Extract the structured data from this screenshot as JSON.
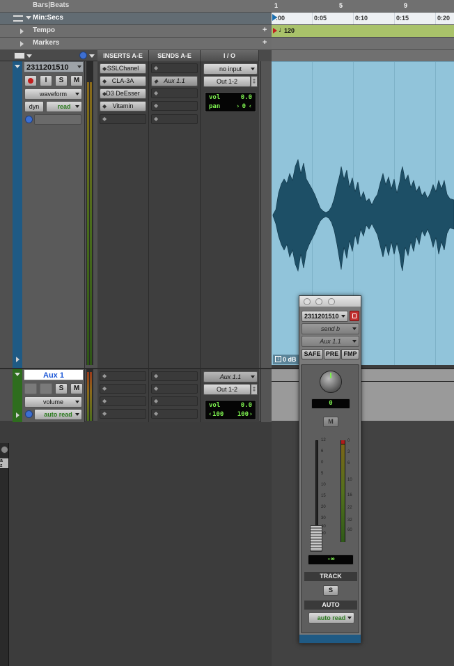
{
  "rulers": {
    "bars_beats": "Bars|Beats",
    "min_secs": "Min:Secs",
    "tempo": "Tempo",
    "markers": "Markers",
    "bar_ticks": [
      "1",
      "5",
      "9"
    ],
    "time_ticks": [
      ":00",
      "0:05",
      "0:10",
      "0:15",
      "0:20"
    ],
    "tempo_value": "120",
    "plus": "+"
  },
  "columns": {
    "inserts": "INSERTS A-E",
    "sends": "SENDS A-E",
    "io": "I / O"
  },
  "track1": {
    "name": "2311201510",
    "buttons": [
      "I",
      "S",
      "M"
    ],
    "view": "waveform",
    "dyn": "dyn",
    "automation": "read",
    "inserts": [
      "SSLChanel",
      "CLA-3A",
      "D3 DeEsser",
      "Vitamin"
    ],
    "send": "Aux 1.1",
    "input": "no input",
    "output": "Out 1-2",
    "vol_label": "vol",
    "vol_value": "0.0",
    "pan_label": "pan",
    "pan_value": "0",
    "clip_db": "0 dB",
    "color": "#1f5a84"
  },
  "track2": {
    "name": "Aux 1",
    "buttons": [
      "S",
      "M"
    ],
    "view": "volume",
    "automation": "auto read",
    "input": "Aux 1.1",
    "output": "Out 1-2",
    "vol_label": "vol",
    "vol_value": "0.0",
    "pan_left": "100",
    "pan_right": "100",
    "color": "#2e6d1e"
  },
  "send_window": {
    "track": "2311201510",
    "send": "send b",
    "destination": "Aux 1.1",
    "buttons": [
      "SAFE",
      "PRE",
      "FMP"
    ],
    "pan_value": "0",
    "mute": "M",
    "fader_scale": [
      "12",
      "6",
      "0",
      "5",
      "10",
      "15",
      "20",
      "30",
      "40",
      "60"
    ],
    "meter_scale": [
      "0",
      "3",
      "6",
      "10",
      "16",
      "22",
      "32",
      "60"
    ],
    "level": "-∞",
    "track_label": "TRACK",
    "solo": "S",
    "auto_label": "AUTO",
    "auto_mode": "auto read"
  },
  "colors": {
    "timeline_bg": "#91c4da",
    "waveform": "#1d4f66",
    "tempo_bar": "#a9c26a"
  }
}
